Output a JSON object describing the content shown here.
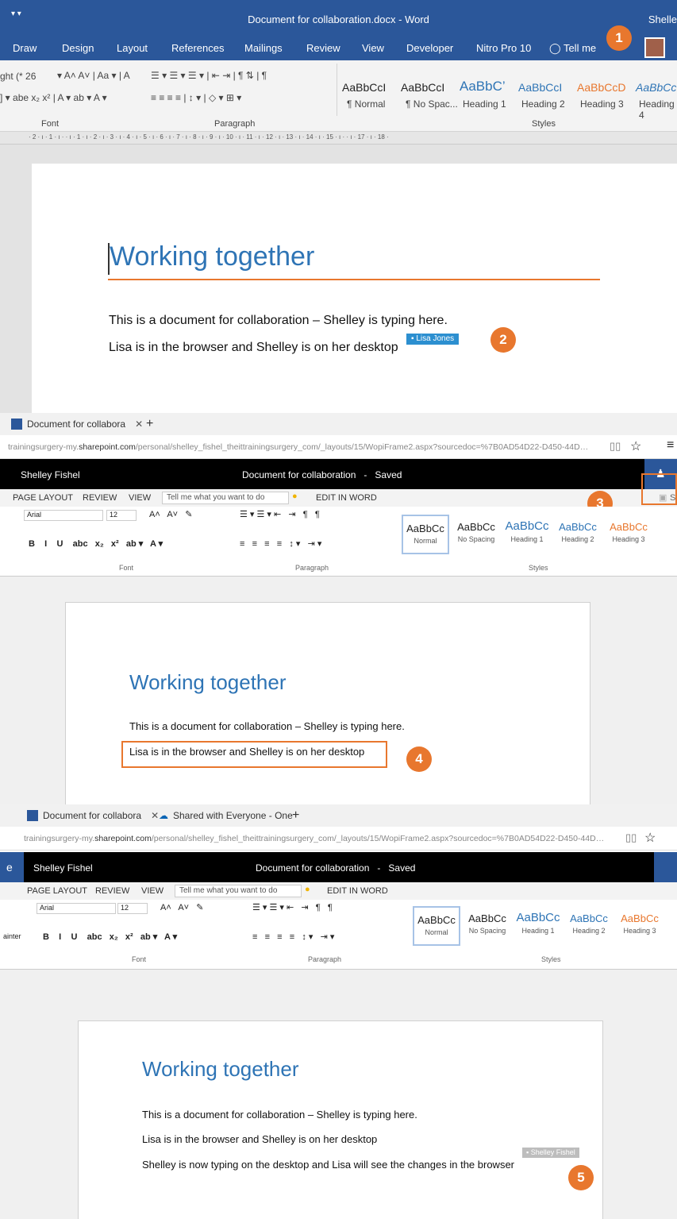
{
  "word": {
    "qat": "▾  ▾",
    "title": "Document for collaboration.docx  -  Word",
    "user": "Shelle",
    "tabs": [
      "Draw",
      "Design",
      "Layout",
      "References",
      "Mailings",
      "Review",
      "View",
      "Developer",
      "Nitro Pro 10",
      "Tell me"
    ],
    "font_size": "ght (* 26",
    "groups": {
      "font": "Font",
      "paragraph": "Paragraph",
      "styles": "Styles"
    },
    "styles": [
      {
        "sample": "AaBbCcI",
        "name": "¶ Normal"
      },
      {
        "sample": "AaBbCcI",
        "name": "¶ No Spac..."
      },
      {
        "sample": "AaBbC’",
        "name": "Heading 1"
      },
      {
        "sample": "AaBbCcI",
        "name": "Heading 2"
      },
      {
        "sample": "AaBbCcD",
        "name": "Heading 3"
      },
      {
        "sample": "AaBbCcI",
        "name": "Heading 4"
      }
    ],
    "ruler": "· 2 · ı · 1 · ı ·  · ı · 1 · ı · 2 · ı · 3 · ı · 4 · ı · 5 · ı · 6 · ı · 7 · ı · 8 · ı · 9 · ı · 10 · ı · 11 · ı · 12 · ı · 13 · ı · 14 · ı · 15 · ı ·  · ı · 17 · ı · 18 ·",
    "doc": {
      "heading": "Working together",
      "line1": "This is a document for collaboration – Shelley is typing here.",
      "line2": "Lisa is in the browser and Shelley is on her desktop",
      "cursor_flag": "Lisa Jones"
    },
    "colors": {
      "ribbon_blue": "#2b579a",
      "accent_orange": "#e8772e",
      "heading_blue": "#2e74b5"
    }
  },
  "browser1": {
    "tab_title": "Document for collabora",
    "url_prefix": "trainingsurgery-my.",
    "url_host": "sharepoint.com",
    "url_rest": "/personal/shelley_fishel_theittrainingsurgery_com/_layouts/15/WopiFrame2.aspx?sourcedoc=%7B0AD54D22-D450-44D…",
    "app_user": "Shelley Fishel",
    "app_title": "Document for collaboration   -   Saved",
    "menu": [
      "PAGE LAYOUT",
      "REVIEW",
      "VIEW"
    ],
    "tell_me": "Tell me what you want to do",
    "edit_in_word": "EDIT IN WORD",
    "font_name": "Arial",
    "font_size": "12",
    "group_font": "Font",
    "group_paragraph": "Paragraph",
    "group_styles": "Styles",
    "share_label": "S",
    "styles": [
      {
        "sample": "AaBbCc",
        "name": "Normal"
      },
      {
        "sample": "AaBbCc",
        "name": "No Spacing"
      },
      {
        "sample": "AaBbCc",
        "name": "Heading 1"
      },
      {
        "sample": "AaBbCc",
        "name": "Heading 2"
      },
      {
        "sample": "AaBbCc",
        "name": "Heading 3"
      }
    ],
    "doc": {
      "heading": "Working together",
      "line1": "This is a document for collaboration – Shelley is typing here.",
      "line2": "Lisa is in the browser and Shelley is on her desktop"
    }
  },
  "browser2": {
    "tab1_title": "Document for collabora",
    "tab2_title": "Shared with Everyone - One",
    "url_prefix": "trainingsurgery-my.",
    "url_host": "sharepoint.com",
    "url_rest": "/personal/shelley_fishel_theittrainingsurgery_com/_layouts/15/WopiFrame2.aspx?sourcedoc=%7B0AD54D22-D450-44D…",
    "app_left": "e",
    "app_user": "Shelley Fishel",
    "app_title": "Document for collaboration   -   Saved",
    "menu": [
      "PAGE LAYOUT",
      "REVIEW",
      "VIEW"
    ],
    "tell_me": "Tell me what you want to do",
    "edit_in_word": "EDIT IN WORD",
    "font_name": "Arial",
    "font_size": "12",
    "painter": "ainter",
    "group_font": "Font",
    "group_paragraph": "Paragraph",
    "group_styles": "Styles",
    "styles": [
      {
        "sample": "AaBbCc",
        "name": "Normal"
      },
      {
        "sample": "AaBbCc",
        "name": "No Spacing"
      },
      {
        "sample": "AaBbCc",
        "name": "Heading 1"
      },
      {
        "sample": "AaBbCc",
        "name": "Heading 2"
      },
      {
        "sample": "AaBbCc",
        "name": "Heading 3"
      }
    ],
    "doc": {
      "heading": "Working together",
      "line1": "This is a document for collaboration – Shelley is typing here.",
      "line2": "Lisa is in the browser and Shelley is on her desktop",
      "line3": "Shelley is now typing on the desktop and Lisa will see the changes in the browser",
      "cursor_flag": "Shelley Fishel"
    }
  },
  "callouts": [
    "1",
    "2",
    "3",
    "4",
    "5"
  ]
}
